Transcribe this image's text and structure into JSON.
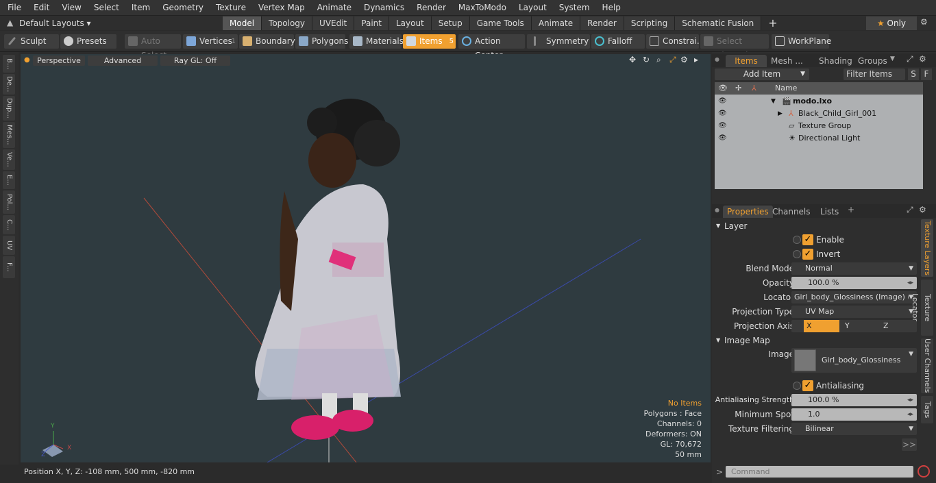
{
  "menu": [
    "File",
    "Edit",
    "View",
    "Select",
    "Item",
    "Geometry",
    "Texture",
    "Vertex Map",
    "Animate",
    "Dynamics",
    "Render",
    "MaxToModo",
    "Layout",
    "System",
    "Help"
  ],
  "layouts": "Default Layouts",
  "tabs": [
    "Model",
    "Topology",
    "UVEdit",
    "Paint",
    "Layout",
    "Setup",
    "Game Tools",
    "Animate",
    "Render",
    "Scripting",
    "Schematic Fusion"
  ],
  "only_label": "Only",
  "toolbar": {
    "sculpt": "Sculpt",
    "presets": "Presets",
    "auto_select": "Auto Select",
    "vertices": "Vertices",
    "vertices_count": "1",
    "boundary": "Boundary",
    "polygons": "Polygons",
    "materials": "Materials",
    "items": "Items",
    "items_count": "5",
    "action_center": "Action Center",
    "symmetry": "Symmetry",
    "falloff": "Falloff",
    "constraints": "Constrai...",
    "select_through": "Select Through",
    "workplane": "WorkPlane"
  },
  "left_tabs": [
    "B...",
    "De...",
    "Dup...",
    "Mes...",
    "Ve...",
    "E...",
    "Pol...",
    "C...",
    "UV",
    "F..."
  ],
  "viewport": {
    "perspective": "Perspective",
    "advanced": "Advanced",
    "raygl": "Ray GL: Off",
    "info": {
      "no_items": "No Items",
      "polygons": "Polygons : Face",
      "channels": "Channels: 0",
      "deformers": "Deformers: ON",
      "gl": "GL: 70,672",
      "size": "50 mm"
    },
    "axis": {
      "y": "Y",
      "x": "X",
      "z": "Z"
    }
  },
  "status": "Position X, Y, Z:   -108 mm, 500 mm, -820 mm",
  "items_panel": {
    "tabs": [
      "Items",
      "Mesh ...",
      "Shading",
      "Groups"
    ],
    "add_item": "Add Item",
    "filter": "Filter Items",
    "s": "S",
    "f": "F",
    "name_header": "Name",
    "rows": [
      "modo.lxo",
      "Black_Child_Girl_001",
      "Texture Group",
      "Directional Light"
    ]
  },
  "props_panel": {
    "tabs": [
      "Properties",
      "Channels",
      "Lists"
    ],
    "layer": "Layer",
    "enable": "Enable",
    "invert": "Invert",
    "blend_mode_label": "Blend Mode",
    "blend_mode": "Normal",
    "opacity_label": "Opacity",
    "opacity": "100.0 %",
    "locator_label": "Locator",
    "locator": "Girl_body_Glossiness (Image) ( ...",
    "proj_type_label": "Projection Type",
    "proj_type": "UV Map",
    "proj_axis_label": "Projection Axis",
    "axes": [
      "X",
      "Y",
      "Z"
    ],
    "image_map": "Image Map",
    "image_label": "Image",
    "image": "Girl_body_Glossiness",
    "antialiasing": "Antialiasing",
    "aa_strength_label": "Antialiasing Strength",
    "aa_strength": "100.0 %",
    "min_spot_label": "Minimum Spot",
    "min_spot": "1.0",
    "tex_filter_label": "Texture Filtering",
    "tex_filter": "Bilinear",
    "more": ">>",
    "side_tabs": [
      "Texture Layers",
      "Texture Locator",
      "User Channels",
      "Tags"
    ]
  },
  "command_placeholder": "Command"
}
